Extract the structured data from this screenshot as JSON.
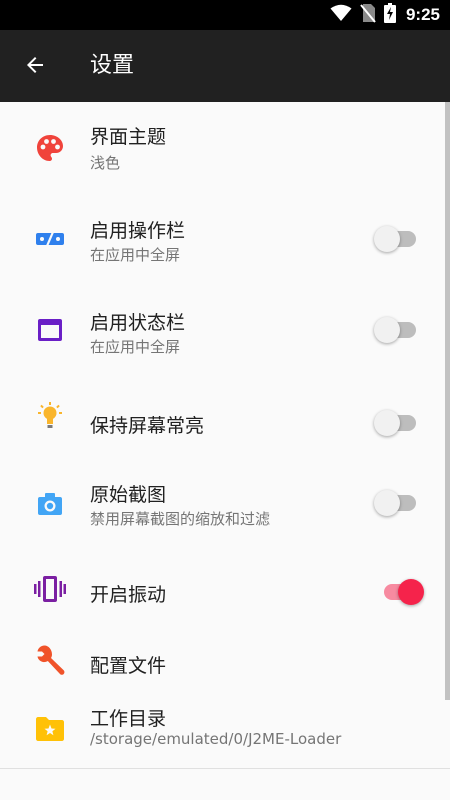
{
  "status_bar": {
    "time": "9:25"
  },
  "toolbar": {
    "title": "设置"
  },
  "colors": {
    "toolbar_bg": "#212121",
    "switch_on_thumb": "#f5234b",
    "switch_on_track": "#f78aa0",
    "switch_off_thumb": "#f1f1f1",
    "switch_off_track": "#bdbdbd"
  },
  "settings": [
    {
      "title": "界面主题",
      "subtitle": "浅色",
      "icon": "palette-icon"
    },
    {
      "title": "启用操作栏",
      "subtitle": "在应用中全屏",
      "icon": "action-bar-icon",
      "toggle": false
    },
    {
      "title": "启用状态栏",
      "subtitle": "在应用中全屏",
      "icon": "window-icon",
      "toggle": false
    },
    {
      "title": "保持屏幕常亮",
      "icon": "lightbulb-icon",
      "toggle": false
    },
    {
      "title": "原始截图",
      "subtitle": "禁用屏幕截图的缩放和过滤",
      "icon": "camera-icon",
      "toggle": false
    },
    {
      "title": "开启振动",
      "icon": "vibration-icon",
      "toggle": true
    },
    {
      "title": "配置文件",
      "icon": "wrench-icon"
    },
    {
      "title": "工作目录",
      "subtitle": "/storage/emulated/0/J2ME-Loader",
      "icon": "folder-star-icon"
    }
  ]
}
